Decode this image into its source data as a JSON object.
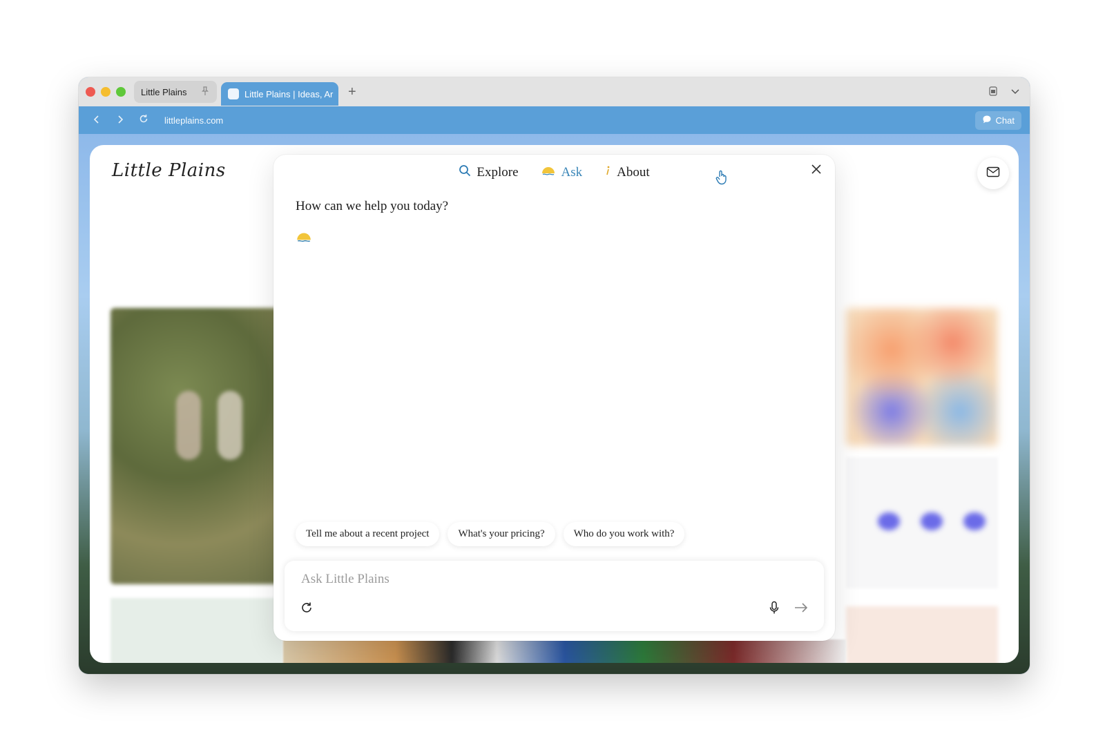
{
  "browser": {
    "tabs": [
      {
        "label": "Little Plains"
      },
      {
        "label": "Little Plains | Ideas, Ar"
      }
    ],
    "new_tab_label": "+",
    "url": "littleplains.com",
    "chat_label": "Chat"
  },
  "site": {
    "logo": "Little Plains"
  },
  "modal": {
    "nav": [
      {
        "label": "Explore",
        "icon": "search-icon"
      },
      {
        "label": "Ask",
        "icon": "sun-icon"
      },
      {
        "label": "About",
        "icon": "info-icon"
      }
    ],
    "greeting": "How can we help you today?",
    "suggestions": [
      "Tell me about a recent project",
      "What's your pricing?",
      "Who do you work with?"
    ],
    "input": {
      "placeholder": "Ask Little Plains",
      "value": ""
    }
  },
  "colors": {
    "accent": "#3a86b8",
    "browser_blue": "#5a9fd8",
    "sun": "#f2c53a"
  }
}
